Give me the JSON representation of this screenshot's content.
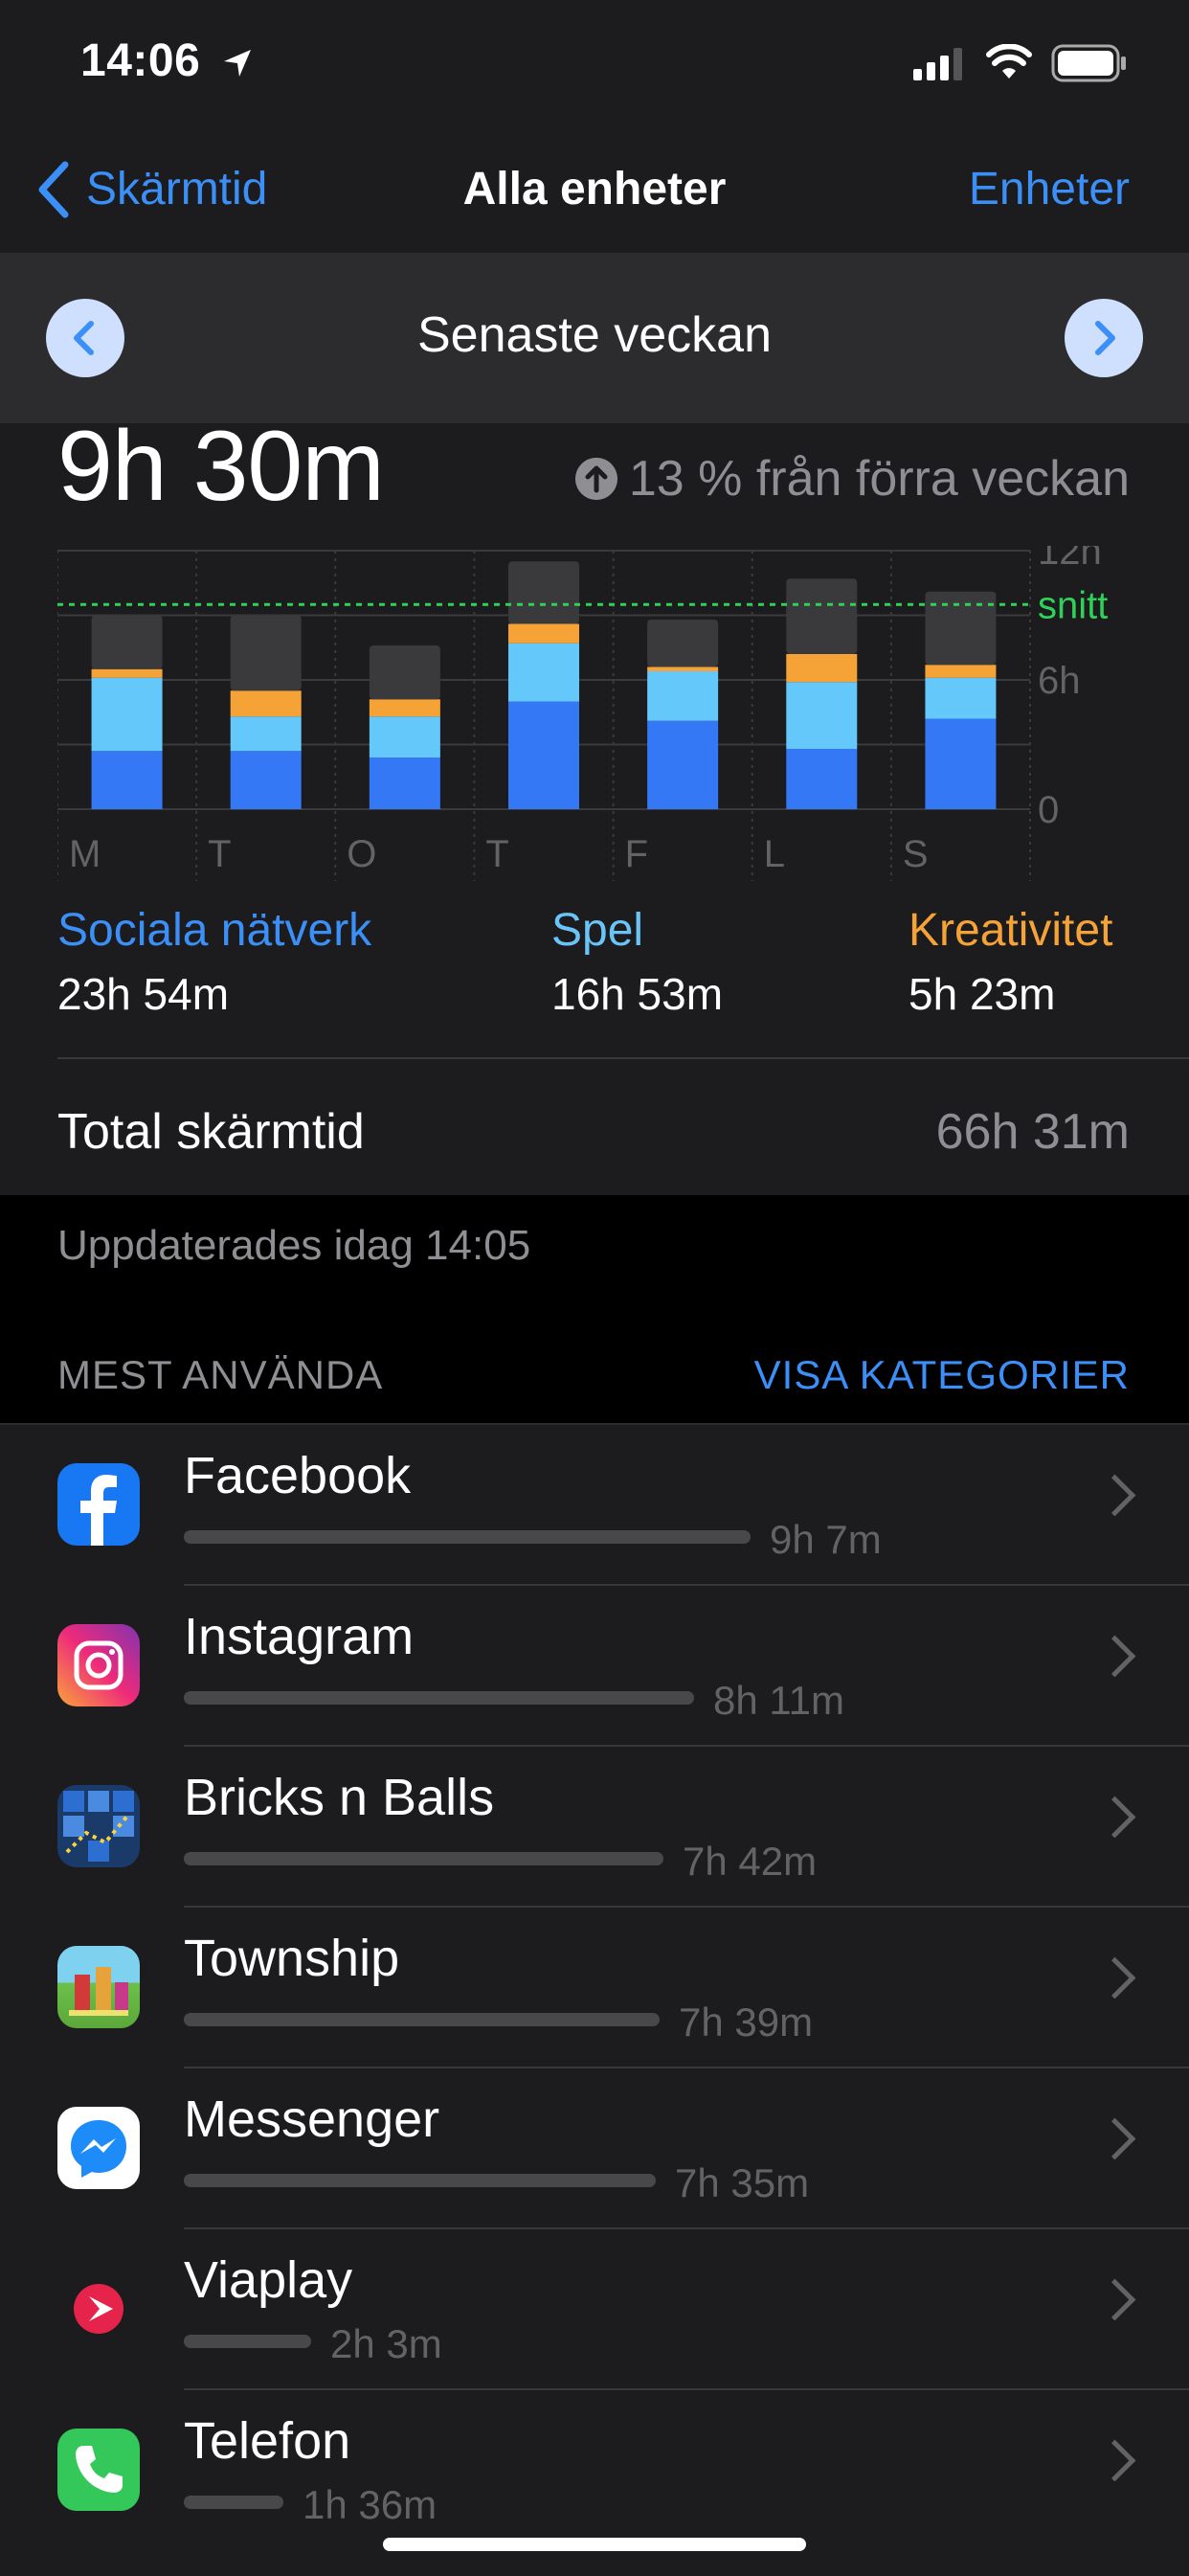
{
  "status_bar": {
    "time": "14:06"
  },
  "nav": {
    "back_label": "Skärmtid",
    "title": "Alla enheter",
    "right_label": "Enheter"
  },
  "week_selector": {
    "title": "Senaste veckan"
  },
  "summary": {
    "total": "9h 30m",
    "delta_text": "13 % från förra veckan"
  },
  "chart_data": {
    "type": "bar",
    "stacked": true,
    "categories": [
      "M",
      "T",
      "O",
      "T",
      "F",
      "L",
      "S"
    ],
    "y_tick_labels": [
      "12h",
      "6h",
      "0"
    ],
    "ylim": [
      0,
      12
    ],
    "average_label": "snitt",
    "average": 9.5,
    "series": [
      {
        "name": "Sociala nätverk",
        "color": "#3478f6",
        "values": [
          2.7,
          2.7,
          2.4,
          5.0,
          4.1,
          2.8,
          4.2
        ]
      },
      {
        "name": "Spel",
        "color": "#64c8fa",
        "values": [
          3.4,
          1.6,
          1.9,
          2.7,
          2.3,
          3.1,
          1.9
        ]
      },
      {
        "name": "Kreativitet",
        "color": "#f5a237",
        "values": [
          0.4,
          1.2,
          0.8,
          0.9,
          0.2,
          1.3,
          0.6
        ]
      },
      {
        "name": "",
        "color": "#3a3a3c",
        "values": [
          2.5,
          3.5,
          2.5,
          2.9,
          2.2,
          3.5,
          3.4
        ]
      }
    ]
  },
  "legend": [
    {
      "name": "Sociala nätverk",
      "value": "23h 54m",
      "color": "#3b8ff6"
    },
    {
      "name": "Spel",
      "value": "16h 53m",
      "color": "#6ac4f8"
    },
    {
      "name": "Kreativitet",
      "value": "5h 23m",
      "color": "#f5a237"
    }
  ],
  "total_row": {
    "label": "Total skärmtid",
    "value": "66h 31m"
  },
  "updated": "Uppdaterades idag 14:05",
  "section": {
    "title": "MEST ANVÄNDA",
    "action": "VISA KATEGORIER"
  },
  "apps": [
    {
      "name": "Facebook",
      "time": "9h 7m",
      "fraction": 1.0,
      "icon": "facebook-icon"
    },
    {
      "name": "Instagram",
      "time": "8h 11m",
      "fraction": 0.9,
      "icon": "instagram-icon"
    },
    {
      "name": "Bricks n Balls",
      "time": "7h 42m",
      "fraction": 0.846,
      "icon": "bricks-n-balls-icon"
    },
    {
      "name": "Township",
      "time": "7h 39m",
      "fraction": 0.84,
      "icon": "township-icon"
    },
    {
      "name": "Messenger",
      "time": "7h 35m",
      "fraction": 0.832,
      "icon": "messenger-icon"
    },
    {
      "name": "Viaplay",
      "time": "2h 3m",
      "fraction": 0.224,
      "icon": "viaplay-icon"
    },
    {
      "name": "Telefon",
      "time": "1h 36m",
      "fraction": 0.175,
      "icon": "phone-icon"
    }
  ]
}
